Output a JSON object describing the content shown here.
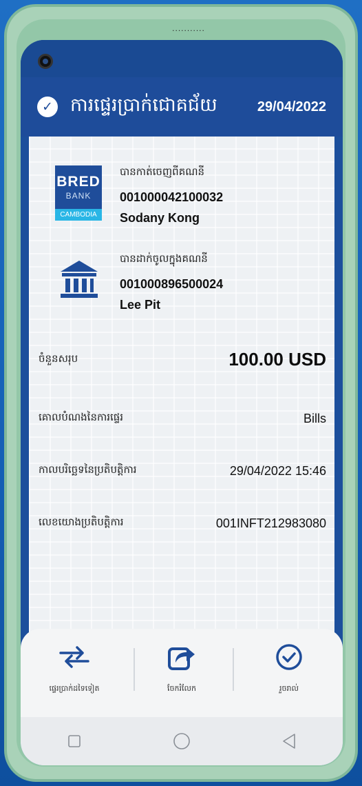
{
  "device": {
    "speaker_dots": "..........."
  },
  "header": {
    "title": "ការផ្ទេរប្រាក់ជោគជ័យ",
    "date": "29/04/2022"
  },
  "from_account": {
    "label": "បានកាត់ចេញពីគណនី",
    "number": "001000042100032",
    "name": "Sodany Kong",
    "logo": {
      "line1": "BRED",
      "line2": "BANK",
      "line3": "CAMBODIA"
    }
  },
  "to_account": {
    "label": "បានដាក់ចូលក្នុងគណនី",
    "number": "001000896500024",
    "name": "Lee Pit",
    "icon": "bank-building-icon"
  },
  "details": {
    "total_label": "ចំនួនសរុប",
    "total_value": "100.00 USD",
    "purpose_label": "គោលបំណងនៃការផ្ទេរ",
    "purpose_value": "Bills",
    "datetime_label": "កាលបរិច្ឆេទនៃប្រតិបត្តិការ",
    "datetime_value": "29/04/2022 15:46",
    "reference_label": "លេខយោងប្រតិបត្តិការ",
    "reference_value": "001INFT212983080"
  },
  "actions": [
    {
      "label": "ផ្ទេរប្រាក់ដទៃទៀត",
      "icon": "transfer-arrows-icon"
    },
    {
      "label": "ចែករំលែក",
      "icon": "share-icon"
    },
    {
      "label": "រួចរាល់",
      "icon": "done-check-icon"
    }
  ],
  "colors": {
    "primary": "#1e4c9a",
    "accent": "#29b6e6"
  }
}
